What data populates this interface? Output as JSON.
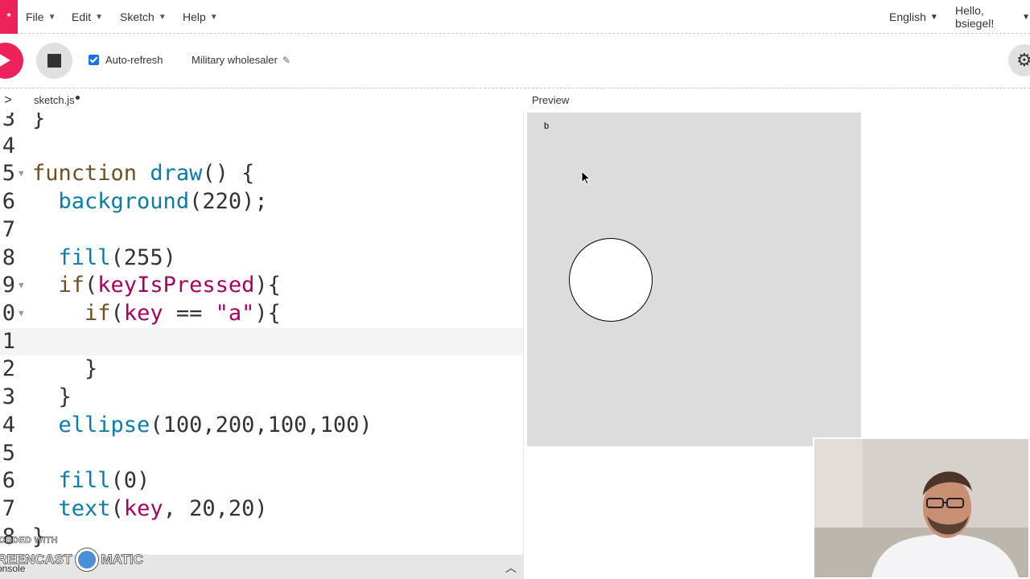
{
  "app": {
    "logo_text": "*"
  },
  "menu": [
    {
      "label": "File"
    },
    {
      "label": "Edit"
    },
    {
      "label": "Sketch"
    },
    {
      "label": "Help"
    }
  ],
  "nav_right": {
    "language": "English",
    "greeting": "Hello, bsiegel!"
  },
  "toolbar": {
    "auto_refresh_label": "Auto-refresh",
    "auto_refresh_checked": true,
    "project_name": "Military wholesaler"
  },
  "editor": {
    "file_tab": "sketch.js",
    "unsaved": true,
    "lines": [
      {
        "num": "3",
        "text": "}"
      },
      {
        "num": "4",
        "text": ""
      },
      {
        "num": "5",
        "text": "function draw() {",
        "fold": true
      },
      {
        "num": "6",
        "text": "  background(220);"
      },
      {
        "num": "7",
        "text": ""
      },
      {
        "num": "8",
        "text": "  fill(255)"
      },
      {
        "num": "9",
        "text": "  if(keyIsPressed){",
        "fold": true
      },
      {
        "num": "0",
        "text": "    if(key == \"a\"){",
        "fold": true
      },
      {
        "num": "1",
        "text": ""
      },
      {
        "num": "2",
        "text": "    }"
      },
      {
        "num": "3",
        "text": "  }"
      },
      {
        "num": "4",
        "text": "  ellipse(100,200,100,100)"
      },
      {
        "num": "5",
        "text": ""
      },
      {
        "num": "6",
        "text": "  fill(0)"
      },
      {
        "num": "7",
        "text": "  text(key, 20,20)"
      },
      {
        "num": "8",
        "text": "}"
      }
    ]
  },
  "preview": {
    "label": "Preview",
    "canvas_text": "b"
  },
  "console": {
    "label": "onsole"
  },
  "watermark": {
    "top": "ORDED WITH",
    "left": "REENCAST",
    "right": "MATIC"
  },
  "colors": {
    "accent": "#ed225d",
    "canvas_bg": "#dcdcdc"
  }
}
